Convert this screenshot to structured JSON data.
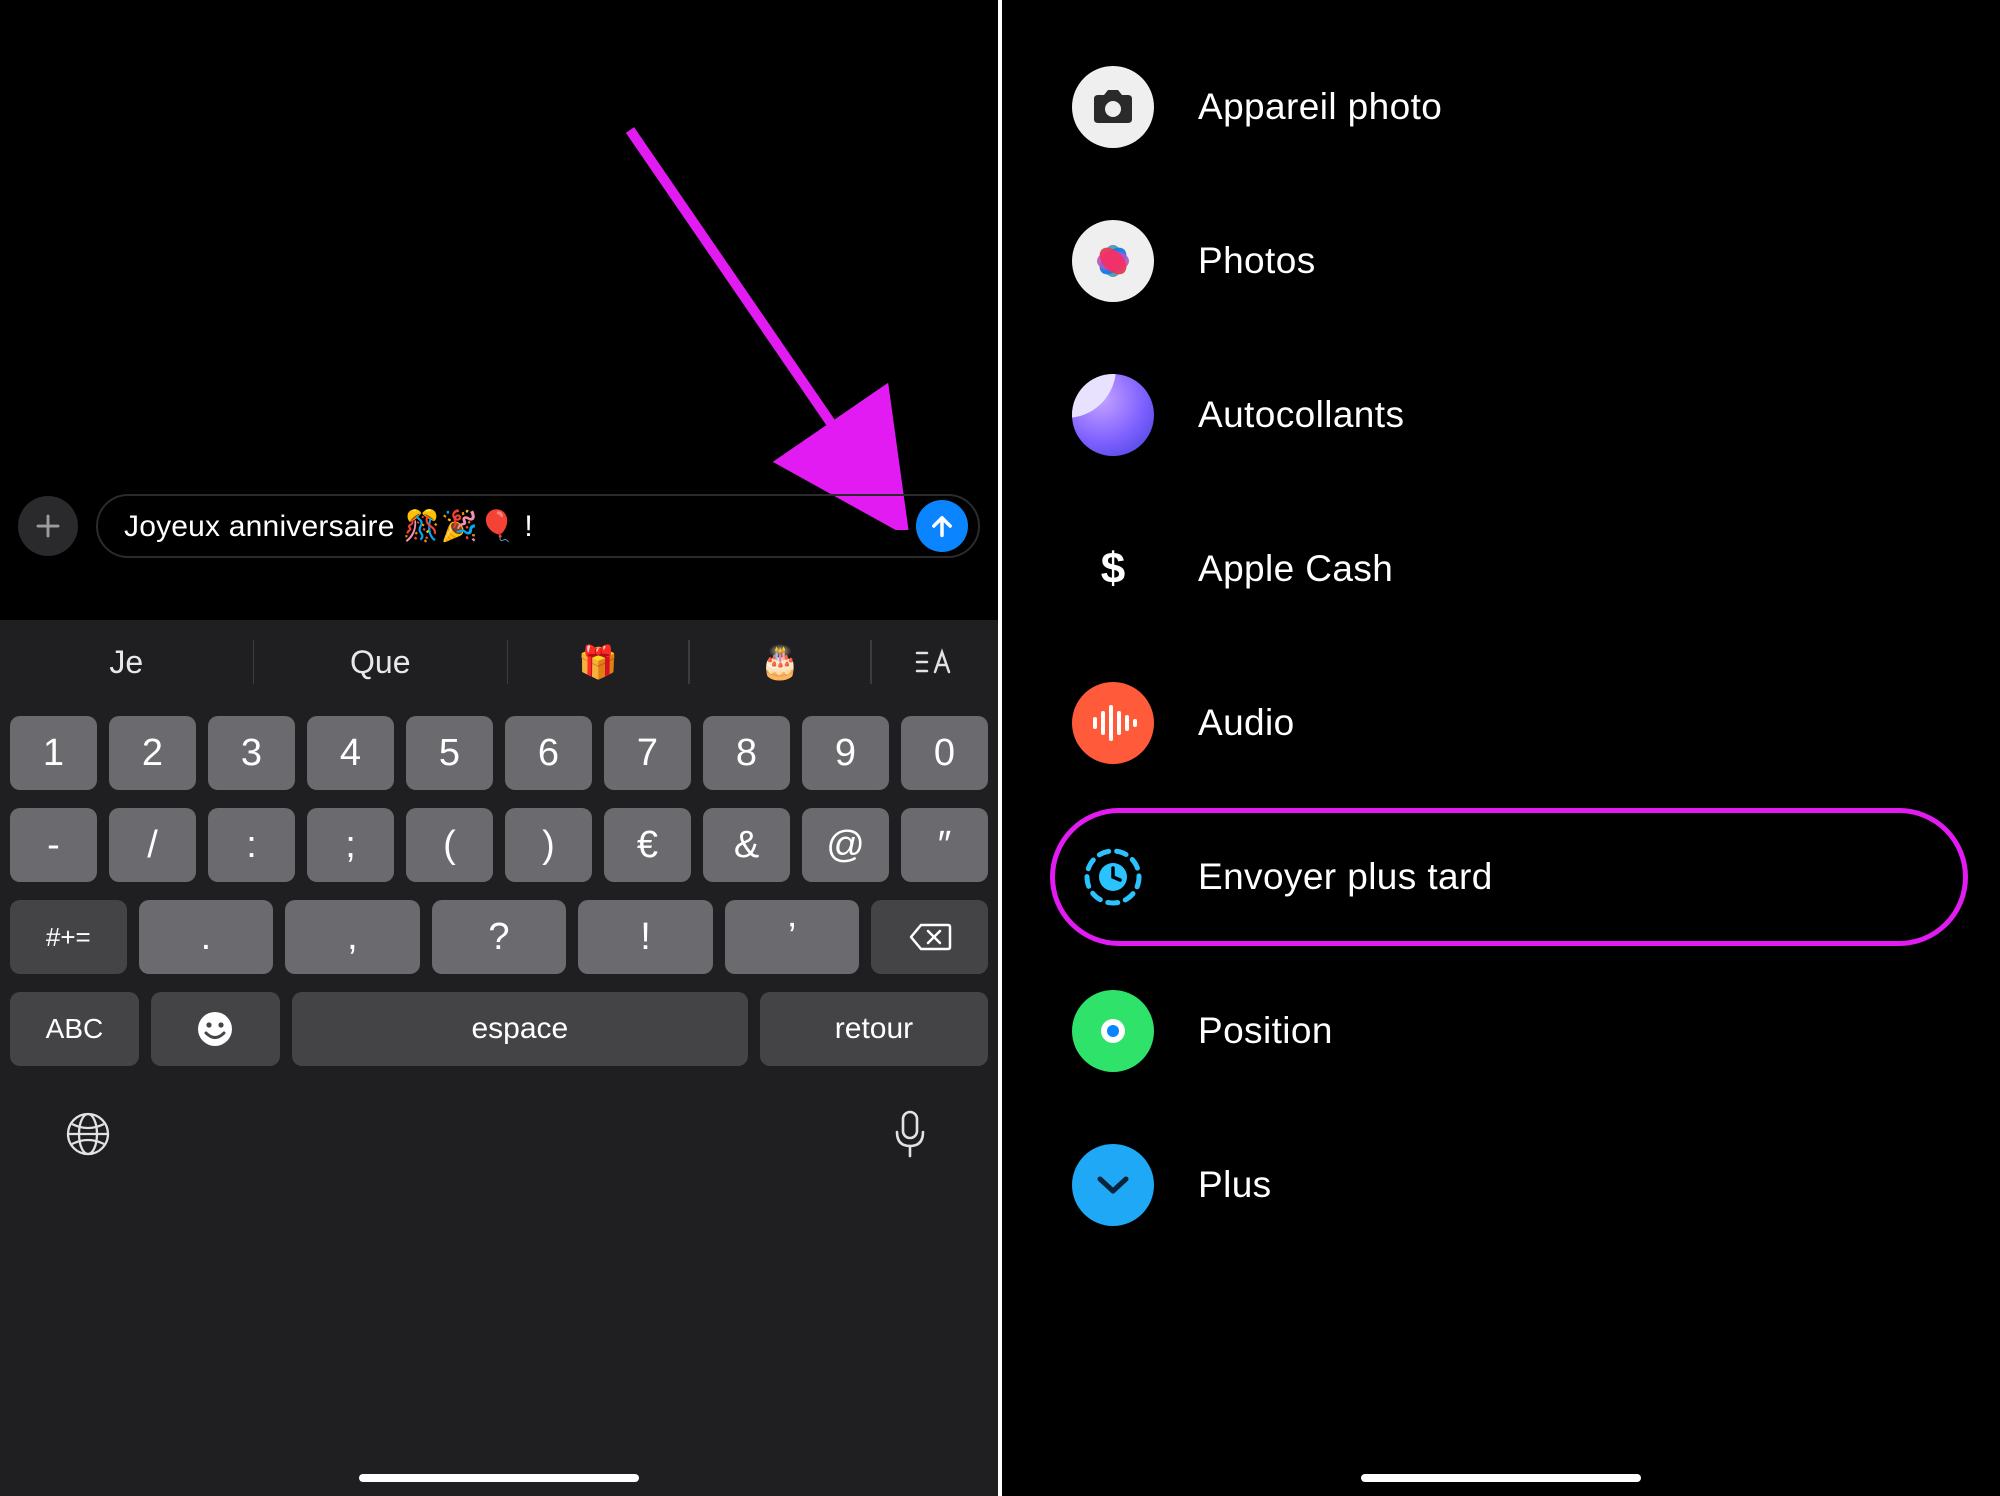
{
  "left": {
    "message_text": "Joyeux anniversaire 🎊🎉🎈  !",
    "predictions": {
      "p1": "Je",
      "p2": "Que",
      "p3_emoji": "🎁",
      "p4_emoji": "🎂"
    },
    "keys": {
      "row1": [
        "1",
        "2",
        "3",
        "4",
        "5",
        "6",
        "7",
        "8",
        "9",
        "0"
      ],
      "row2": [
        "-",
        "/",
        ":",
        ";",
        "(",
        ")",
        "€",
        "&",
        "@",
        "″"
      ],
      "row3_switch": "#+=",
      "row3": [
        ".",
        ",",
        "?",
        "!",
        "’"
      ],
      "abc": "ABC",
      "space": "espace",
      "return": "retour"
    },
    "annotation_color": "#e11bf2"
  },
  "right": {
    "menu": [
      {
        "id": "camera",
        "label": "Appareil photo"
      },
      {
        "id": "photos",
        "label": "Photos"
      },
      {
        "id": "stickers",
        "label": "Autocollants"
      },
      {
        "id": "applecash",
        "label": "Apple Cash"
      },
      {
        "id": "audio",
        "label": "Audio"
      },
      {
        "id": "sendlater",
        "label": "Envoyer plus tard"
      },
      {
        "id": "location",
        "label": "Position"
      },
      {
        "id": "more",
        "label": "Plus"
      }
    ],
    "highlight_color": "#e11bf2"
  }
}
